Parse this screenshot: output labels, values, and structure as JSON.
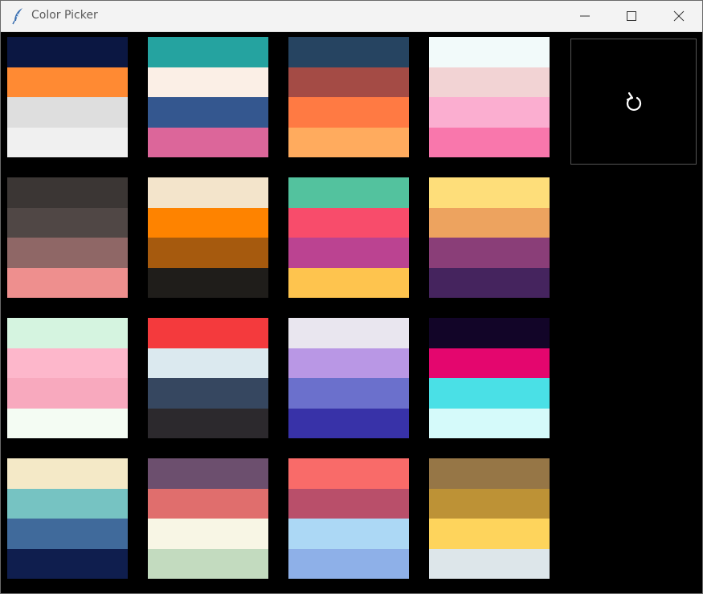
{
  "window": {
    "title": "Color Picker",
    "icons": {
      "app": "feather-icon",
      "minimize": "minimize-icon",
      "maximize": "maximize-icon",
      "close": "close-icon"
    }
  },
  "reload": {
    "icon": "refresh-icon"
  },
  "palettes": [
    [
      "#0b1742",
      "#ff8a33",
      "#dedede",
      "#f0f0f0"
    ],
    [
      "#25a3a0",
      "#fbefe6",
      "#34578f",
      "#dc669a"
    ],
    [
      "#264461",
      "#a44b45",
      "#ff7a43",
      "#ffab5e"
    ],
    [
      "#f2fafa",
      "#f2d3d4",
      "#fbaed0",
      "#f977ac"
    ],
    [
      "#3b3634",
      "#504745",
      "#8f6766",
      "#ee8f8e"
    ],
    [
      "#f3e4cb",
      "#fe8300",
      "#a65a0e",
      "#1f1d1a"
    ],
    [
      "#53c29e",
      "#f84c6b",
      "#bb4391",
      "#fec44e"
    ],
    [
      "#fede7a",
      "#eda35f",
      "#8a3e78",
      "#45245e"
    ],
    [
      "#d5f4e0",
      "#fdb7cb",
      "#f8a9be",
      "#f4fcf3"
    ],
    [
      "#f43a3d",
      "#dbe9ef",
      "#364760",
      "#2c292d"
    ],
    [
      "#e9e6ef",
      "#b997e5",
      "#6b70cc",
      "#3832a8"
    ],
    [
      "#120528",
      "#e4066e",
      "#4ae0e6",
      "#d5fafa"
    ],
    [
      "#f4e9c7",
      "#76c3c2",
      "#406a9b",
      "#0f1e4e"
    ],
    [
      "#6c4f6e",
      "#e06e6d",
      "#f8f6e5",
      "#c3dbbf"
    ],
    [
      "#f96b69",
      "#b94f6a",
      "#acd8f5",
      "#8eb0e8"
    ],
    [
      "#967646",
      "#bd9236",
      "#fed45c",
      "#dde6ea"
    ]
  ]
}
